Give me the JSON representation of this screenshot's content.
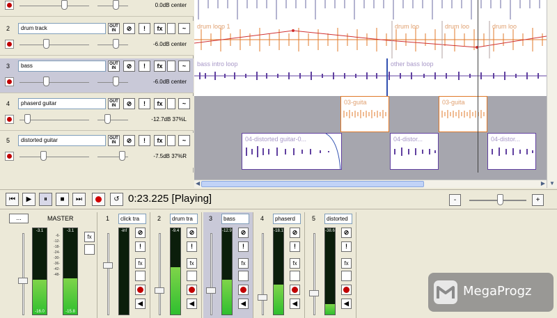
{
  "tracks": [
    {
      "number": "",
      "name": "",
      "volume": "0.0dB center",
      "selected": false
    },
    {
      "number": "2",
      "name": "drum track",
      "volume": "-6.0dB center",
      "selected": false
    },
    {
      "number": "3",
      "name": "bass",
      "volume": "-6.0dB center",
      "selected": true
    },
    {
      "number": "4",
      "name": "phaserd guitar",
      "volume": "-12.7dB 37%L",
      "selected": false
    },
    {
      "number": "5",
      "name": "distorted guitar",
      "volume": "-7.5dB 37%R",
      "selected": false
    }
  ],
  "track_buttons": {
    "io": "OUT IN",
    "fx": "fx",
    "mute": "!",
    "env": "~"
  },
  "items": {
    "drum_loop_1": "drum loop 1",
    "drum_loop_b": "drum loo",
    "drum_loop_c": "drum loo",
    "drum_loop_d": "drum loo",
    "bass_intro": "bass intro loop",
    "other_bass": "other bass loop",
    "guitar_a": "03-guita",
    "guitar_b": "03-guita",
    "dist_a": "04-distorted guitar-0...",
    "dist_b": "04-distor...",
    "dist_c": "04-distor..."
  },
  "transport": {
    "time": "0:23.225 [Playing]",
    "minus": "-",
    "plus": "+"
  },
  "mixer": {
    "master_label": "MASTER",
    "master_menu": "...",
    "master_peak_l": "-3.1",
    "master_peak_r": "-3.1",
    "master_bottom_l": "-16.0",
    "master_bottom_r": "-15.8",
    "fx": "fx",
    "mute": "!",
    "strips": [
      {
        "number": "1",
        "name": "click tra",
        "peak": "-inf",
        "level": 0.0
      },
      {
        "number": "2",
        "name": "drum tra",
        "peak": "-9.4",
        "level": 0.55
      },
      {
        "number": "3",
        "name": "bass",
        "peak": "-12.9",
        "level": 0.4
      },
      {
        "number": "4",
        "name": "phaserd",
        "peak": "-18.1",
        "level": 0.35
      },
      {
        "number": "5",
        "name": "distorted",
        "peak": "-38.6",
        "level": 0.12
      }
    ],
    "scale": [
      "-6-",
      "-12-",
      "-18-",
      "-24-",
      "-30-",
      "-36-",
      "-42-",
      "-48-"
    ]
  },
  "watermark": "MegaProgz",
  "colors": {
    "drum": "#e07828",
    "bass": "#6040a0",
    "guitar": "#e07828",
    "dist": "#6040a0"
  }
}
